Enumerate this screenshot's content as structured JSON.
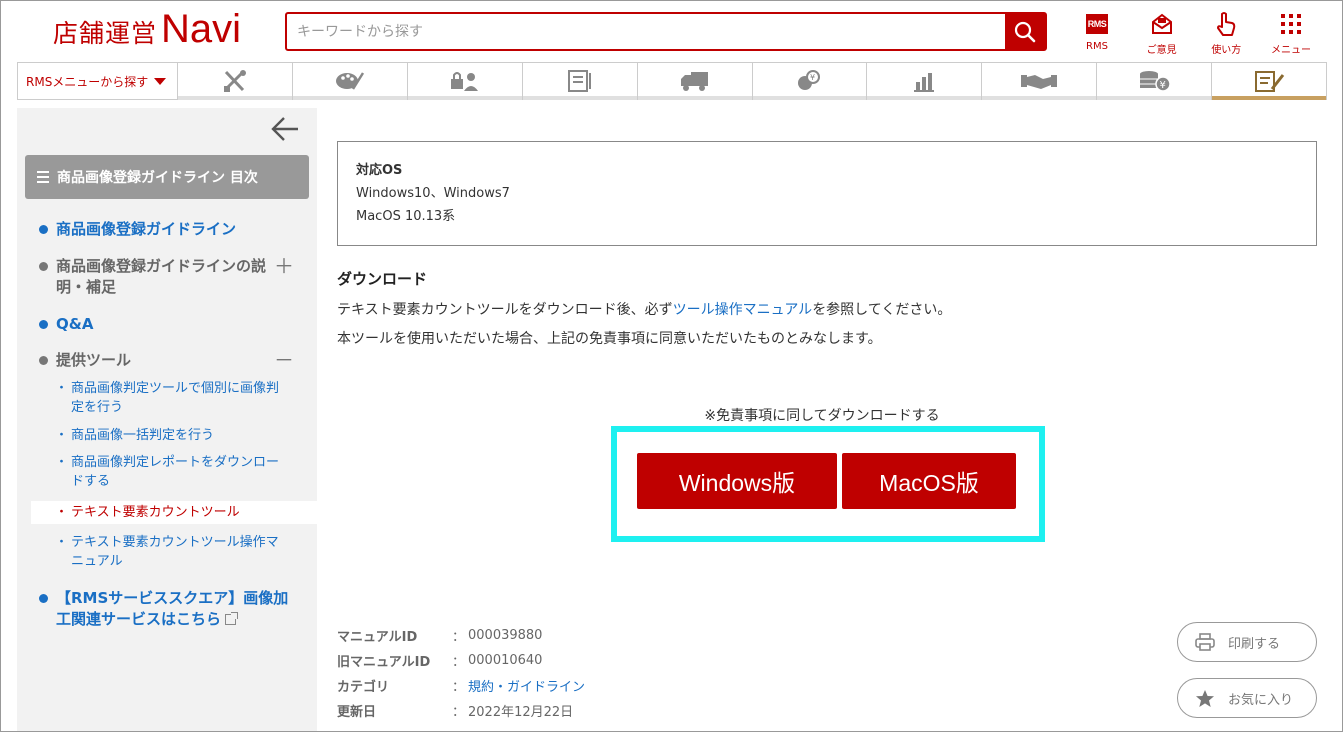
{
  "header": {
    "logo_ja": "店舗運営",
    "logo_en": "Navi",
    "search_placeholder": "キーワードから探す",
    "icons": [
      {
        "name": "rms",
        "badge": "RMS",
        "label": "RMS"
      },
      {
        "name": "opinion",
        "label": "ご意見"
      },
      {
        "name": "howto",
        "label": "使い方"
      },
      {
        "name": "menu",
        "label": "メニュー"
      }
    ]
  },
  "catnav": {
    "rms_menu_label": "RMSメニューから探す",
    "tabs": [
      "tools-icon",
      "palette-icon",
      "lock-person-icon",
      "document-icon",
      "truck-icon",
      "chat-yen-icon",
      "chart-icon",
      "handshake-icon",
      "coins-yen-icon",
      "edit-doc-icon"
    ],
    "active_index": 9
  },
  "sidebar": {
    "toc_title": "商品画像登録ガイドライン 目次",
    "items": [
      {
        "label": "商品画像登録ガイドライン"
      },
      {
        "label": "商品画像登録ガイドラインの説明・補足",
        "toggle": "＋"
      },
      {
        "label": "Q&A"
      },
      {
        "label": "提供ツール",
        "toggle": "－"
      }
    ],
    "subitems": [
      {
        "bullet": "・",
        "label": "商品画像判定ツールで個別に画像判定を行う"
      },
      {
        "bullet": "・",
        "label": "商品画像一括判定を行う"
      },
      {
        "bullet": "・",
        "label": "商品画像判定レポートをダウンロードする"
      },
      {
        "bullet": "・",
        "label": "テキスト要素カウントツール"
      },
      {
        "bullet": "・",
        "label": "テキスト要素カウントツール操作マニュアル"
      }
    ],
    "rms_service_link": "【RMSサービススクエア】画像加工関連サービスはこちら"
  },
  "main": {
    "os": {
      "title": "対応OS",
      "line1": "Windows10、Windows7",
      "line2": "MacOS 10.13系"
    },
    "download": {
      "title": "ダウンロード",
      "line1_before": "テキスト要素カウントツールをダウンロード後、必ず",
      "line1_link": "ツール操作マニュアル",
      "line1_after": "を参照してください。",
      "line2": "本ツールを使用いただいた場合、上記の免責事項に同意いただいたものとみなします。",
      "agree_note": "※免責事項に同してダウンロードする",
      "windows_button": "Windows版",
      "mac_button": "MacOS版"
    },
    "meta": [
      {
        "key": "マニュアルID",
        "sep": "：",
        "value": "000039880"
      },
      {
        "key": "旧マニュアルID",
        "sep": "：",
        "value": "000010640"
      },
      {
        "key": "カテゴリ",
        "sep": "：",
        "value": "規約・ガイドライン"
      },
      {
        "key": "更新日",
        "sep": "：",
        "value": "2022年12月22日"
      }
    ],
    "print_label": "印刷する",
    "favorite_label": "お気に入り"
  },
  "colors": {
    "brand_red": "#bf0000",
    "link_blue": "#1a6fc4",
    "highlight_cyan": "#1ef0f0",
    "active_tab_underline": "#c8a060"
  }
}
